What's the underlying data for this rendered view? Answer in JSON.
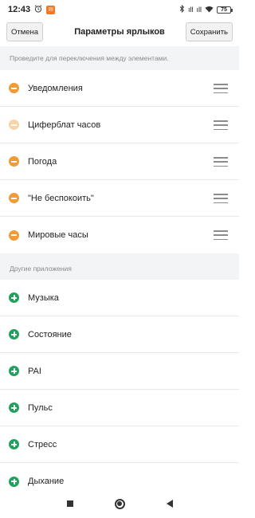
{
  "status": {
    "time": "12:43",
    "notification_text": "✉",
    "network": "ıll",
    "network2": "ıll",
    "battery": "75"
  },
  "header": {
    "cancel_label": "Отмена",
    "title": "Параметры ярлыков",
    "save_label": "Сохранить"
  },
  "hint": "Проведите для переключения между элементами.",
  "active_items": [
    {
      "label": "Уведомления",
      "faded": false
    },
    {
      "label": "Циферблат часов",
      "faded": true
    },
    {
      "label": "Погода",
      "faded": false
    },
    {
      "label": "\"Не беспокоить\"",
      "faded": false
    },
    {
      "label": "Мировые часы",
      "faded": false
    }
  ],
  "other_section_title": "Другие приложения",
  "other_items": [
    {
      "label": "Музыка"
    },
    {
      "label": "Состояние"
    },
    {
      "label": "PAI"
    },
    {
      "label": "Пульс"
    },
    {
      "label": "Стресс"
    },
    {
      "label": "Дыхание"
    }
  ],
  "colors": {
    "remove": "#f19a38",
    "remove_faded": "#f8d4a8",
    "add": "#1fa35c",
    "section_bg": "#f3f4f6"
  },
  "icons": {
    "alarm": "alarm-icon",
    "bluetooth": "bluetooth-icon",
    "wifi": "wifi-icon",
    "remove": "minus-circle-icon",
    "add": "plus-circle-icon",
    "drag": "drag-handle-icon"
  }
}
